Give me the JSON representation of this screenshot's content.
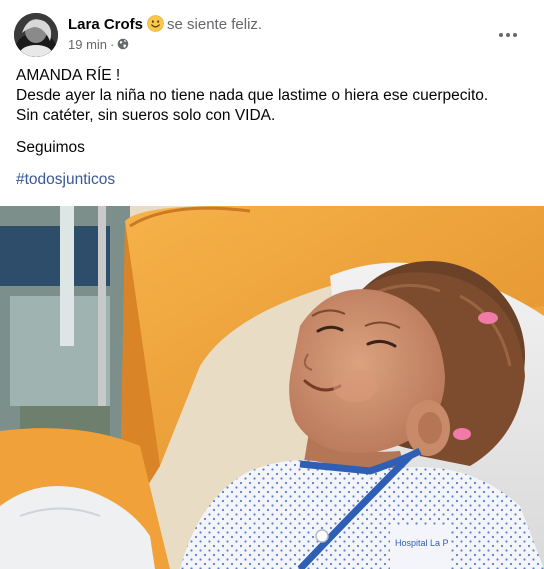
{
  "post": {
    "author_name": "Lara Crofs",
    "feeling_icon": "smiling-face-emoji",
    "feeling_text": "se siente feliz.",
    "time": "19 min",
    "separator": "·",
    "privacy_icon": "globe-icon",
    "more_icon": "more-horizontal-icon",
    "lines": [
      "AMANDA RÍE !",
      "Desde ayer la niña no tiene nada que lastime o hiera ese cuerpecito.",
      "Sin catéter, sin sueros  solo con VIDA."
    ],
    "paragraph2": "Seguimos",
    "hashtag": "#todosjunticos",
    "photo_caption_visible": "Hospital La P"
  },
  "colors": {
    "secondary_text": "#65676b",
    "hashtag": "#385898",
    "chair_orange": "#f0a63c",
    "gown_blue": "#2f5fb4"
  }
}
